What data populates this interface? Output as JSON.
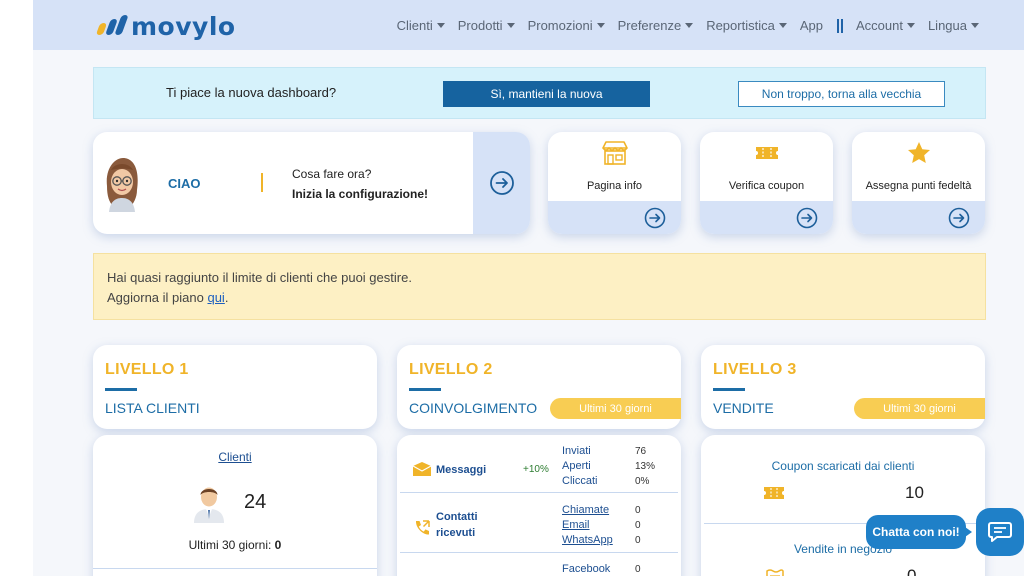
{
  "brand": {
    "name": "movylo",
    "logo_colors": [
      "#f0b429",
      "#1f63a8",
      "#1f63a8"
    ]
  },
  "nav": {
    "items": [
      {
        "label": "Clienti",
        "dropdown": true
      },
      {
        "label": "Prodotti",
        "dropdown": true
      },
      {
        "label": "Promozioni",
        "dropdown": true
      },
      {
        "label": "Preferenze",
        "dropdown": true
      },
      {
        "label": "Reportistica",
        "dropdown": true
      },
      {
        "label": "App",
        "dropdown": false
      }
    ],
    "account_label": "Account",
    "language_label": "Lingua"
  },
  "survey": {
    "question": "Ti piace la nuova dashboard?",
    "keep_label": "Sì, mantieni la nuova",
    "back_label": "Non troppo, torna alla vecchia"
  },
  "welcome": {
    "greeting": "CIAO",
    "question": "Cosa fare ora?",
    "action": "Inizia la configurazione!"
  },
  "quick_actions": [
    {
      "label": "Pagina info",
      "icon": "store-icon"
    },
    {
      "label": "Verifica coupon",
      "icon": "ticket-icon"
    },
    {
      "label": "Assegna punti fedeltà",
      "icon": "star-icon"
    }
  ],
  "warning": {
    "line1": "Hai quasi raggiunto il limite di clienti che puoi gestire.",
    "line2_prefix": "Aggiorna il piano ",
    "link": "qui",
    "line2_suffix": "."
  },
  "levels": {
    "l1": {
      "title": "LIVELLO 1",
      "subtitle": "LISTA CLIENTI",
      "clients_link": "Clienti",
      "clients_count": "24",
      "last30_label": "Ultimi 30 giorni:",
      "last30_value": "0"
    },
    "l2": {
      "title": "LIVELLO 2",
      "subtitle": "COINVOLGIMENTO",
      "period": "Ultimi 30 giorni",
      "messages": {
        "label": "Messaggi",
        "delta": "+10%",
        "stats": [
          {
            "label": "Inviati",
            "value": "76"
          },
          {
            "label": "Aperti",
            "value": "13%"
          },
          {
            "label": "Cliccati",
            "value": "0%"
          }
        ]
      },
      "contacts": {
        "label_line1": "Contatti",
        "label_line2": "ricevuti",
        "stats": [
          {
            "label": "Chiamate",
            "value": "0"
          },
          {
            "label": "Email",
            "value": "0"
          },
          {
            "label": "WhatsApp",
            "value": "0"
          }
        ]
      },
      "social": {
        "stats": [
          {
            "label": "Facebook",
            "value": "0"
          }
        ]
      }
    },
    "l3": {
      "title": "LIVELLO 3",
      "subtitle": "VENDITE",
      "period": "Ultimi 30 giorni",
      "coupons_label": "Coupon scaricati dai clienti",
      "coupons_value": "10",
      "store_sales_label": "Vendite in negozio",
      "store_sales_value": "0"
    }
  },
  "chat": {
    "label": "Chatta con noi!"
  },
  "colors": {
    "accent": "#f0b429",
    "primary": "#1d6da6",
    "nav_bg": "#d6e2f7",
    "pill": "#f8cd53"
  }
}
